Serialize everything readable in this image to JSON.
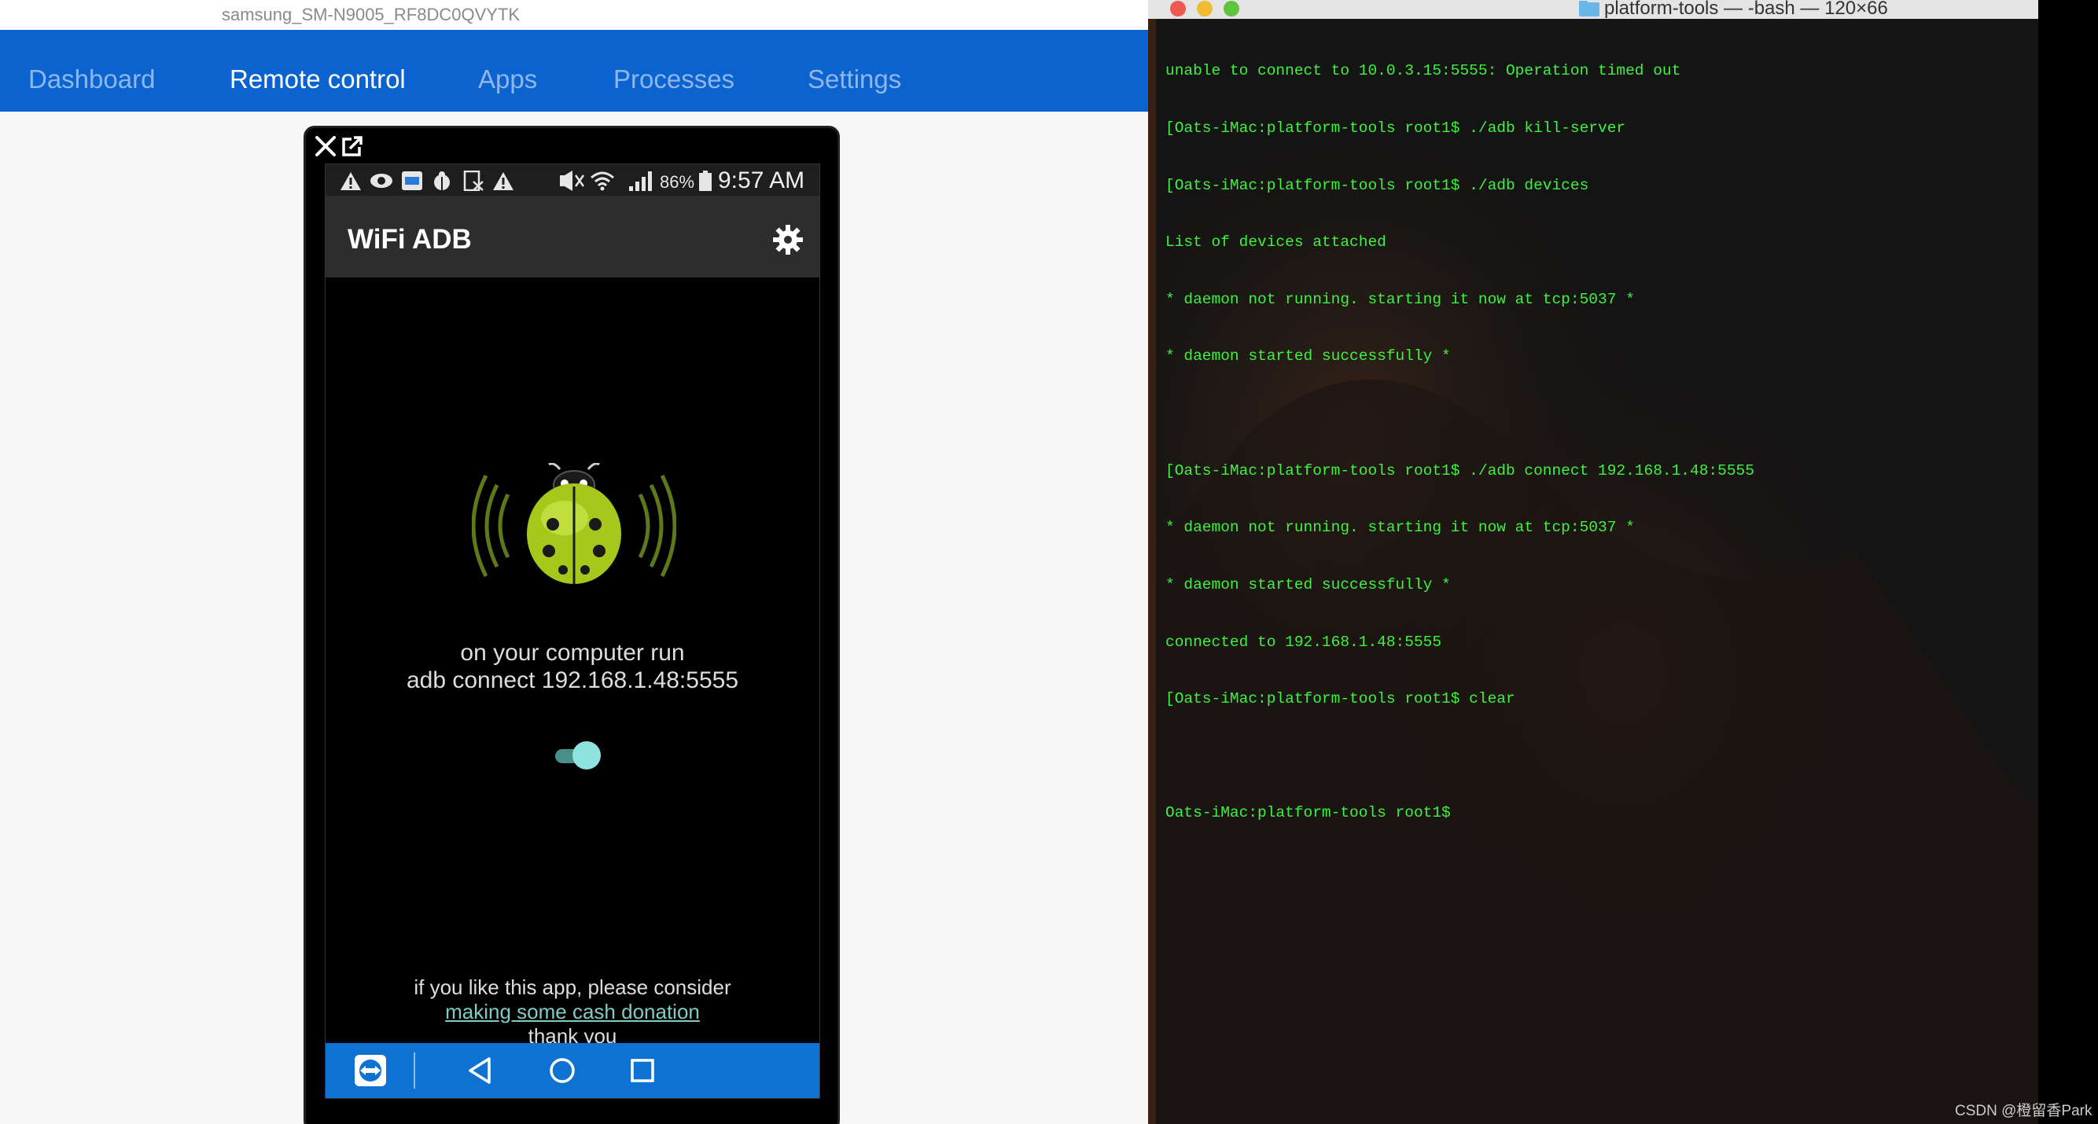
{
  "left_window": {
    "title": "samsung_SM-N9005_RF8DC0QVYTK",
    "nav": [
      {
        "label": "Dashboard",
        "active": false
      },
      {
        "label": "Remote control",
        "active": true
      },
      {
        "label": "Apps",
        "active": false
      },
      {
        "label": "Processes",
        "active": false
      },
      {
        "label": "Settings",
        "active": false
      }
    ]
  },
  "phone": {
    "statusbar": {
      "battery_text": "86%",
      "time": "9:57 AM"
    },
    "app_title": "WiFi ADB",
    "run_line1": "on your computer run",
    "run_line2": "adb connect 192.168.1.48:5555",
    "toggle_on": true,
    "donate_line1": "if you like this app, please consider",
    "donate_link": "making some cash donation",
    "donate_line3": "thank you"
  },
  "terminal": {
    "title": "platform-tools — -bash — 120×66",
    "lines": [
      "unable to connect to 10.0.3.15:5555: Operation timed out",
      "[Oats-iMac:platform-tools root1$ ./adb kill-server",
      "[Oats-iMac:platform-tools root1$ ./adb devices",
      "List of devices attached",
      "* daemon not running. starting it now at tcp:5037 *",
      "* daemon started successfully *",
      "",
      "[Oats-iMac:platform-tools root1$ ./adb connect 192.168.1.48:5555",
      "* daemon not running. starting it now at tcp:5037 *",
      "* daemon started successfully *",
      "connected to 192.168.1.48:5555",
      "[Oats-iMac:platform-tools root1$ clear",
      "",
      "Oats-iMac:platform-tools root1$"
    ]
  },
  "watermark": "CSDN @橙留香Park",
  "colors": {
    "navbar": "#0b63cf",
    "terminal_text": "#3ff13f",
    "phone_nav": "#0d72d2",
    "toggle": "#8ee3de"
  }
}
